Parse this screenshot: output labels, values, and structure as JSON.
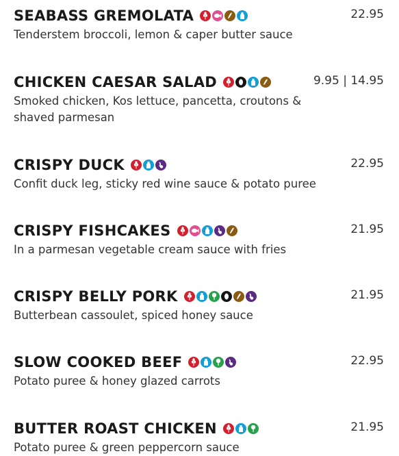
{
  "colors": {
    "gluten": "#d3202f",
    "fish": "#e04f8e",
    "egg": "#8a5c12",
    "milk": "#129fd6",
    "mustard": "#141414",
    "sulphites": "#5b2a82",
    "celery": "#27a14b"
  },
  "items": [
    {
      "name": "SEABASS GREMOLATA",
      "price": "22.95",
      "description": "Tenderstem broccoli, lemon & caper butter sauce",
      "allergens": [
        "gluten",
        "fish",
        "egg",
        "milk"
      ]
    },
    {
      "name": "CHICKEN CAESAR SALAD",
      "price": "9.95 | 14.95",
      "description": "Smoked chicken, Kos lettuce, pancetta, croutons & shaved parmesan",
      "allergens": [
        "gluten",
        "mustard",
        "milk",
        "egg"
      ]
    },
    {
      "name": "CRISPY DUCK",
      "price": "22.95",
      "description": "Confit duck leg, sticky red wine sauce & potato puree",
      "allergens": [
        "gluten",
        "milk",
        "sulphites"
      ]
    },
    {
      "name": "CRISPY FISHCAKES",
      "price": "21.95",
      "description": "In a parmesan vegetable cream sauce with fries",
      "allergens": [
        "gluten",
        "fish",
        "milk",
        "sulphites",
        "egg"
      ]
    },
    {
      "name": "CRISPY BELLY PORK",
      "price": "21.95",
      "description": "Butterbean cassoulet, spiced honey sauce",
      "allergens": [
        "gluten",
        "milk",
        "celery",
        "mustard",
        "egg",
        "sulphites"
      ]
    },
    {
      "name": "SLOW COOKED BEEF",
      "price": "22.95",
      "description": "Potato puree & honey glazed carrots",
      "allergens": [
        "gluten",
        "milk",
        "celery",
        "sulphites"
      ]
    },
    {
      "name": "BUTTER ROAST CHICKEN",
      "price": "21.95",
      "description": "Potato puree & green peppercorn sauce",
      "allergens": [
        "gluten",
        "milk",
        "celery"
      ]
    }
  ]
}
